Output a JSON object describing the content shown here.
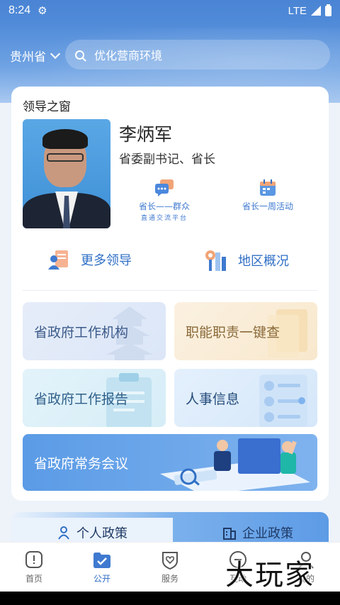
{
  "status": {
    "time": "8:24",
    "network": "LTE",
    "gear_icon": "gear-icon",
    "signal_icon": "signal-icon",
    "battery_icon": "battery-icon"
  },
  "header": {
    "region": "贵州省",
    "search_placeholder": "优化营商环境"
  },
  "leaders": {
    "section_title": "领导之窗",
    "name": "李炳军",
    "title": "省委副书记、省长",
    "actions": [
      {
        "label": "省长——群众",
        "sub": "直通交流平台"
      },
      {
        "label": "省长一周活动"
      }
    ],
    "links": [
      {
        "label": "更多领导"
      },
      {
        "label": "地区概况"
      }
    ]
  },
  "tiles": [
    {
      "label": "省政府工作机构"
    },
    {
      "label": "职能职责一键查"
    },
    {
      "label": "省政府工作报告"
    },
    {
      "label": "人事信息"
    },
    {
      "label": "省政府常务会议"
    }
  ],
  "policy_tabs": [
    {
      "label": "个人政策",
      "active": true
    },
    {
      "label": "企业政策",
      "active": false
    }
  ],
  "bottom_nav": [
    {
      "label": "首页",
      "icon": "home-icon"
    },
    {
      "label": "公开",
      "icon": "folder-check-icon",
      "active": true
    },
    {
      "label": "服务",
      "icon": "heart-shield-icon"
    },
    {
      "label": "互动",
      "icon": "chat-icon"
    },
    {
      "label": "我的",
      "icon": "user-icon"
    }
  ],
  "watermark": "大玩家",
  "colors": {
    "primary": "#2f6fc5",
    "header": "#4f8ad8"
  }
}
